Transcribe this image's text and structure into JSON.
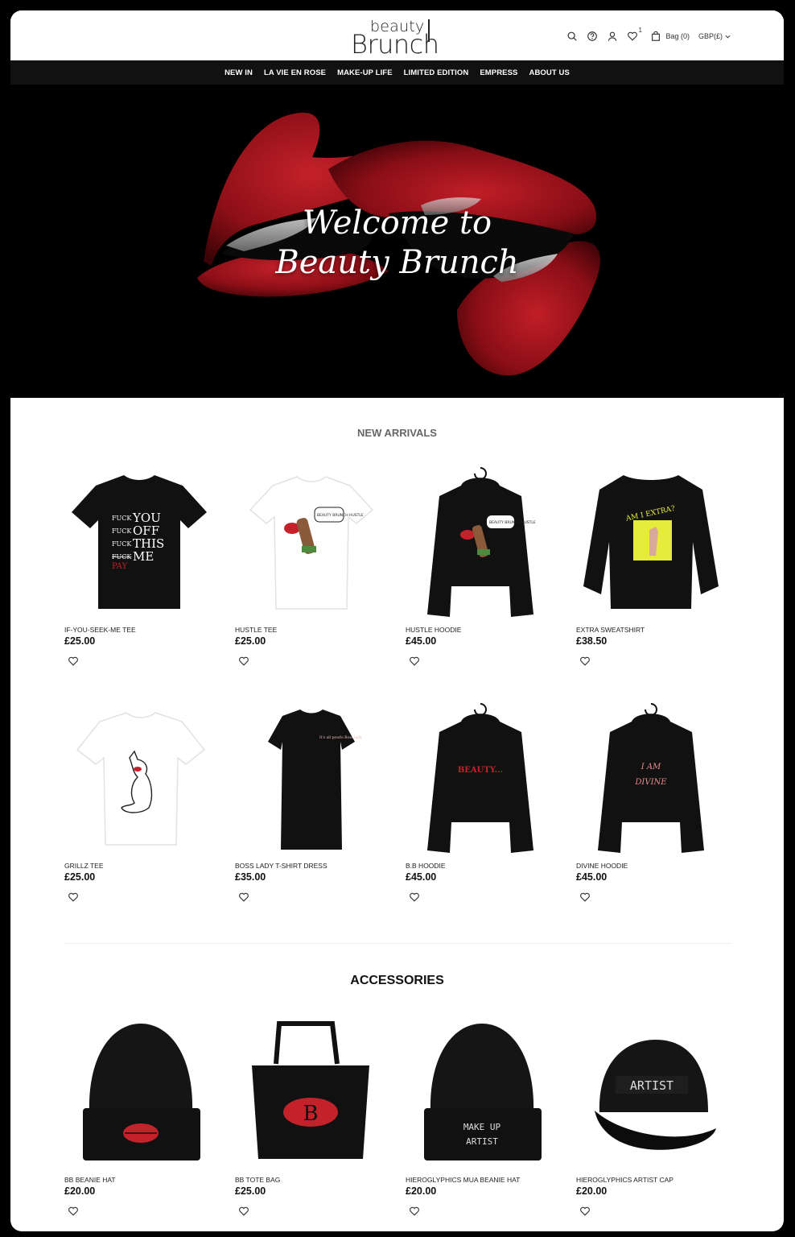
{
  "brand": {
    "logo_top": "beauty",
    "logo_bottom": "Brunch"
  },
  "header": {
    "bag_label": "Bag (0)",
    "wishlist_count": "1",
    "currency": "GBP(£)"
  },
  "nav": [
    "NEW IN",
    "LA VIE EN ROSE",
    "MAKE-UP LIFE",
    "LIMITED EDITION",
    "EMPRESS",
    "ABOUT US"
  ],
  "hero": {
    "line1": "Welcome to",
    "line2": "Beauty Brunch"
  },
  "new_arrivals": {
    "title": "NEW ARRIVALS",
    "products": [
      {
        "name": "IF-YOU-SEEK-ME TEE",
        "price": "£25.00"
      },
      {
        "name": "HUSTLE TEE",
        "price": "£25.00"
      },
      {
        "name": "HUSTLE HOODIE",
        "price": "£45.00"
      },
      {
        "name": "EXTRA SWEATSHIRT",
        "price": "£38.50"
      },
      {
        "name": "GRILLZ TEE",
        "price": "£25.00"
      },
      {
        "name": "BOSS LADY T-SHIRT DRESS",
        "price": "£35.00"
      },
      {
        "name": "B.B HOODIE",
        "price": "£45.00"
      },
      {
        "name": "DIVINE HOODIE",
        "price": "£45.00"
      }
    ]
  },
  "accessories": {
    "title": "ACCESSORIES",
    "products": [
      {
        "name": "BB BEANIE HAT",
        "price": "£20.00"
      },
      {
        "name": "BB TOTE BAG",
        "price": "£25.00"
      },
      {
        "name": "HIEROGLYPHICS MUA BEANIE HAT",
        "price": "£20.00"
      },
      {
        "name": "HIEROGLYPHICS ARTIST CAP",
        "price": "£20.00"
      }
    ]
  },
  "print_text": {
    "tee1": [
      "FUCK",
      "YOU",
      "FUCK",
      "OFF",
      "FUCK",
      "THIS",
      "FUCK",
      "ME",
      "PAY"
    ],
    "hustle_bubble": "BEAUTY BRUNCH HUSTLE",
    "extra": "AM I EXTRA?",
    "bb_hoodie": "BEAUTY...",
    "divine": [
      "I AM",
      "DIVINE"
    ],
    "dress": "It's all pearls Boss lady",
    "mua_beanie": [
      "MAKE UP",
      "ARTIST"
    ],
    "cap": "ARTIST",
    "bb_monogram": "B"
  },
  "colors": {
    "accent_red": "#b3141d",
    "nav_bg": "#111111",
    "frame_bg": "#000000"
  }
}
